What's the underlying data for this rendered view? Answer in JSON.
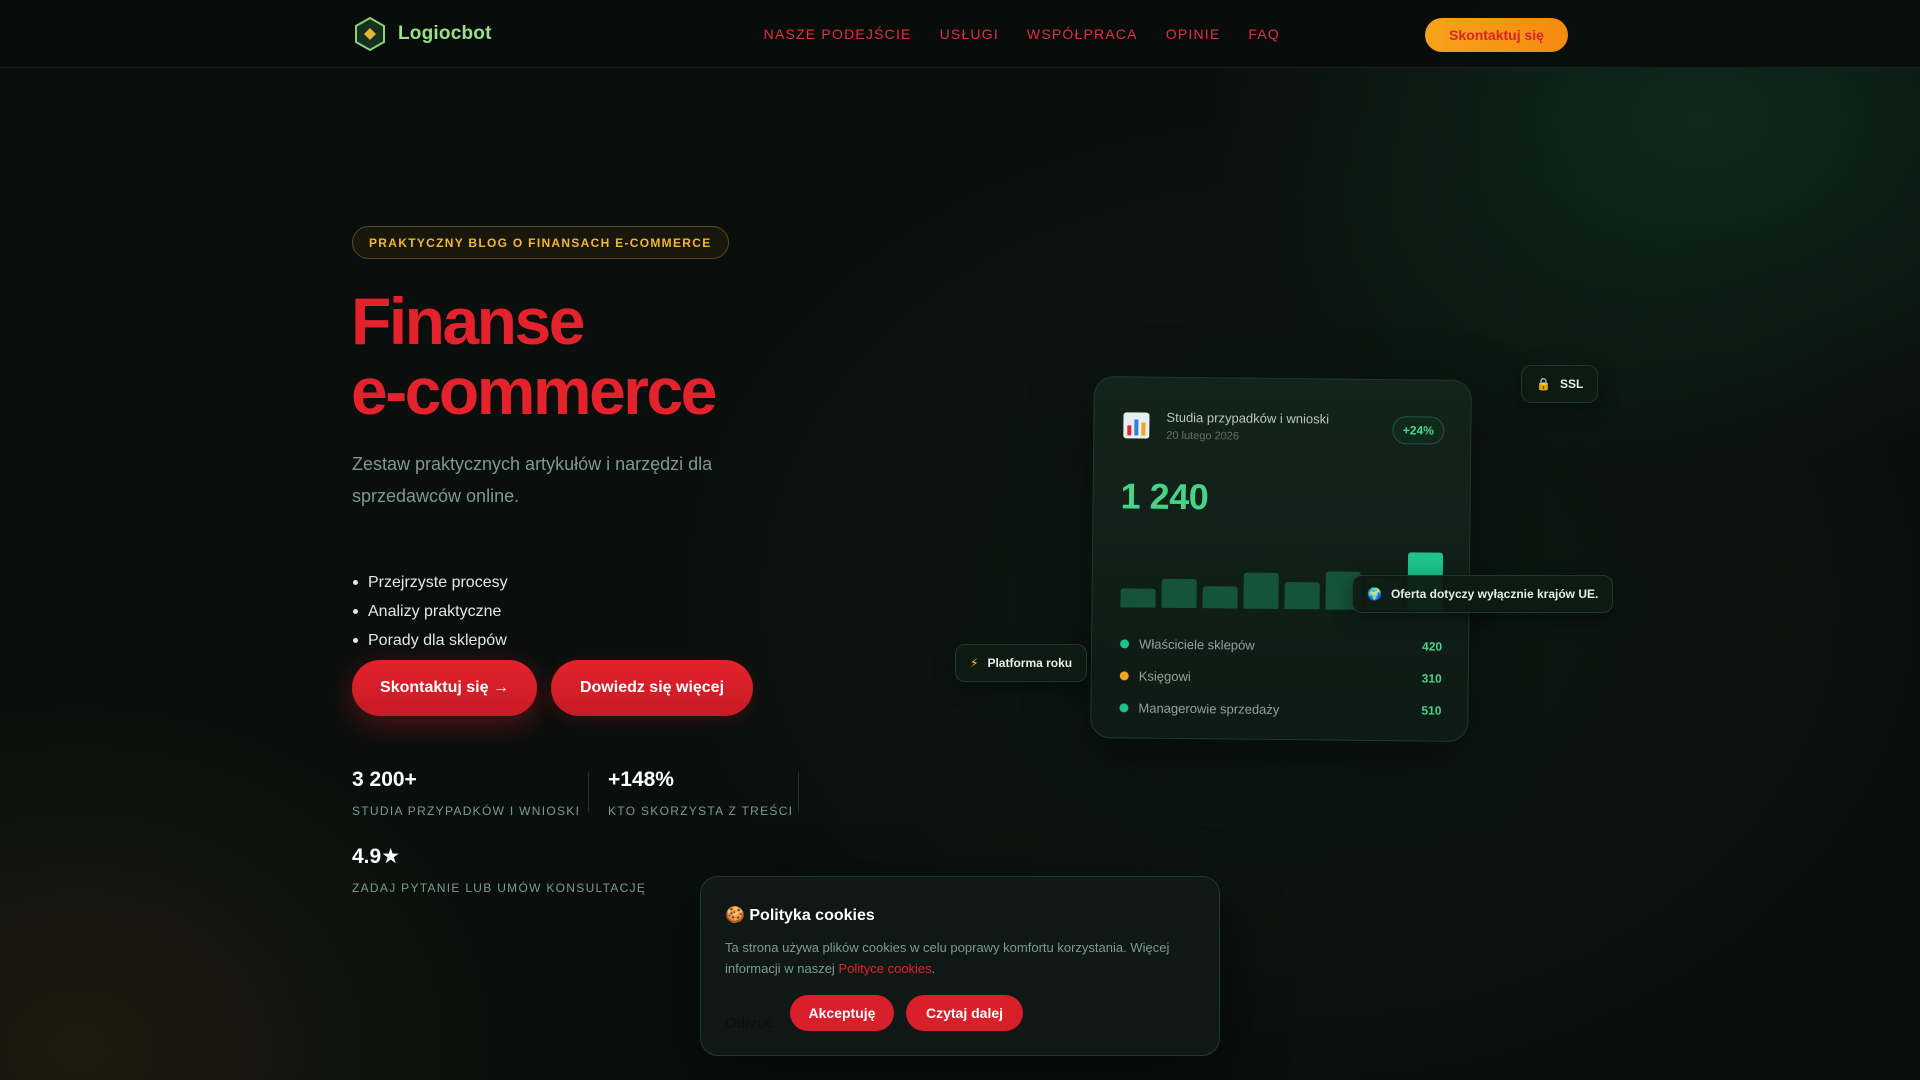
{
  "brand": {
    "name": "Logiocbot",
    "logo_icon": "hexagon-diamond-icon",
    "logo_color": "#9be08a"
  },
  "nav": {
    "items": [
      "NASZE PODEJŚCIE",
      "USŁUGI",
      "WSPÓŁPRACA",
      "OPINIE",
      "FAQ"
    ],
    "cta": "Skontaktuj się"
  },
  "hero": {
    "badge": "PRAKTYCZNY BLOG O FINANSACH E-COMMERCE",
    "title_line1": "Finanse",
    "title_line2": "e-commerce",
    "subtitle": "Zestaw praktycznych artykułów i narzędzi dla sprzedawców online.",
    "bullets": [
      "Przejrzyste procesy",
      "Analizy praktyczne",
      "Porady dla sklepów"
    ],
    "primary_button": "Skontaktuj się →",
    "secondary_button": "Dowiedz się więcej",
    "accent_color": "#e3222c"
  },
  "stats": [
    {
      "value": "3 200+",
      "label": "STUDIA PRZYPADKÓW I WNIOSKI"
    },
    {
      "value": "+148%",
      "label": "KTO SKORZYSTA Z TREŚCI"
    },
    {
      "value": "4.9★",
      "label": "ZADAJ PYTANIE LUB UMÓW KONSULTACJĘ"
    }
  ],
  "card": {
    "icon": "bar-chart-icon",
    "title": "Studia przypadków i wnioski",
    "date": "20 lutego 2026",
    "change": "+24%",
    "big_value": "1 240",
    "bars": [
      0.3,
      0.46,
      0.34,
      0.56,
      0.42,
      0.6,
      0.5,
      0.9
    ],
    "legend": [
      {
        "name": "Właściciele sklepów",
        "value": "420",
        "color": "#1ec28a"
      },
      {
        "name": "Księgowi",
        "value": "310",
        "color": "#f2a21b"
      },
      {
        "name": "Managerowie sprzedaży",
        "value": "510",
        "color": "#1ec28a"
      }
    ]
  },
  "chips": {
    "ssl": {
      "icon": "lock-icon",
      "label": "SSL"
    },
    "eu": {
      "icon": "globe-icon",
      "label": "Oferta dotyczy wyłącznie krajów UE."
    },
    "platform": {
      "icon": "lightning-icon",
      "label": "Platforma roku"
    }
  },
  "cookie": {
    "title": "🍪 Polityka cookies",
    "text": "Ta strona używa plików cookies w celu poprawy komfortu korzystania. Więcej informacji w naszej ",
    "link": "Polityce cookies",
    "text_end": ".",
    "reject": "Odrzuć",
    "accept": "Akceptuję",
    "read_more": "Czytaj dalej"
  }
}
